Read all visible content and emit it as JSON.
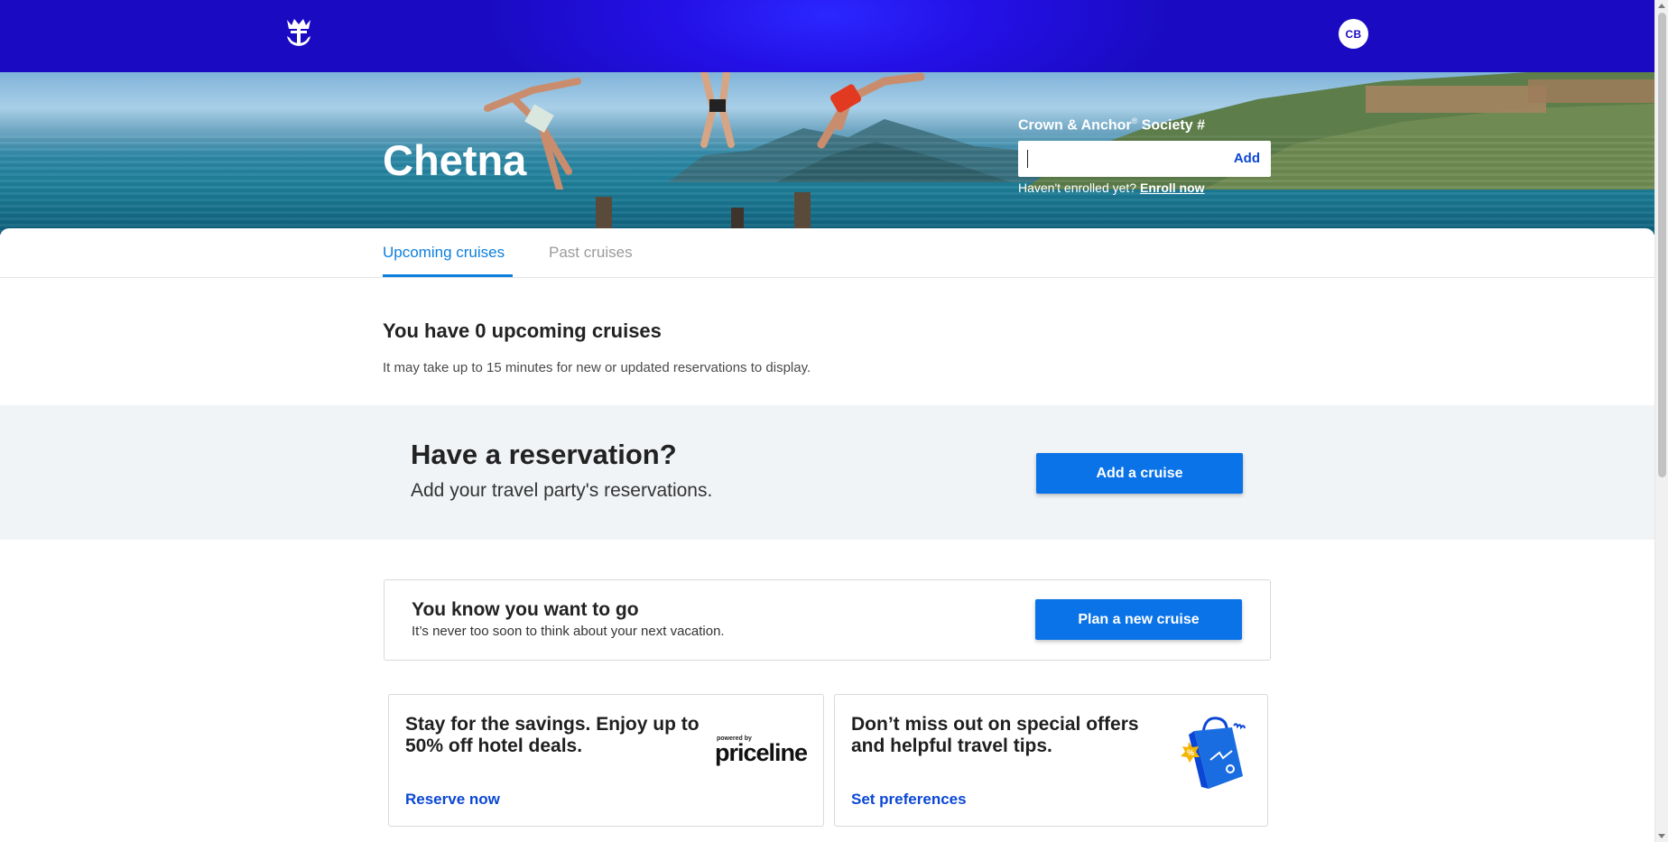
{
  "header": {
    "logo_icon": "royal-caribbean-crown-anchor-icon",
    "avatar_initials": "CB"
  },
  "hero": {
    "name": "Chetna",
    "candc": {
      "label": "Crown & Anchor",
      "label_reg": "®",
      "label_suffix": " Society #",
      "input_value": "",
      "add_label": "Add",
      "enroll_prompt": "Haven't enrolled yet?",
      "enroll_link": "Enroll now"
    }
  },
  "tabs": [
    {
      "label": "Upcoming cruises",
      "active": true
    },
    {
      "label": "Past cruises",
      "active": false
    }
  ],
  "upcoming": {
    "title": "You have 0 upcoming cruises",
    "note": "It may take up to 15 minutes for new or updated reservations to display."
  },
  "reservation": {
    "title": "Have a reservation?",
    "subtitle": "Add your travel party's reservations.",
    "button": "Add a cruise"
  },
  "plan": {
    "title": "You know you want to go",
    "subtitle": "It’s never too soon to think about your next vacation.",
    "button": "Plan a new cruise"
  },
  "promos": {
    "hotel": {
      "title": "Stay for the savings. Enjoy up to 50% off hotel deals.",
      "link": "Reserve now",
      "logo_powered": "powered by",
      "logo_text": "priceline"
    },
    "offers": {
      "title": "Don’t miss out on special offers and helpful travel tips.",
      "link": "Set preferences",
      "icon": "shopping-bag-icon"
    }
  },
  "colors": {
    "header_blue": "#1a0bc2",
    "accent_blue": "#0a73e8",
    "link_blue": "#0a47d6",
    "tab_active": "#0d7fdd"
  }
}
